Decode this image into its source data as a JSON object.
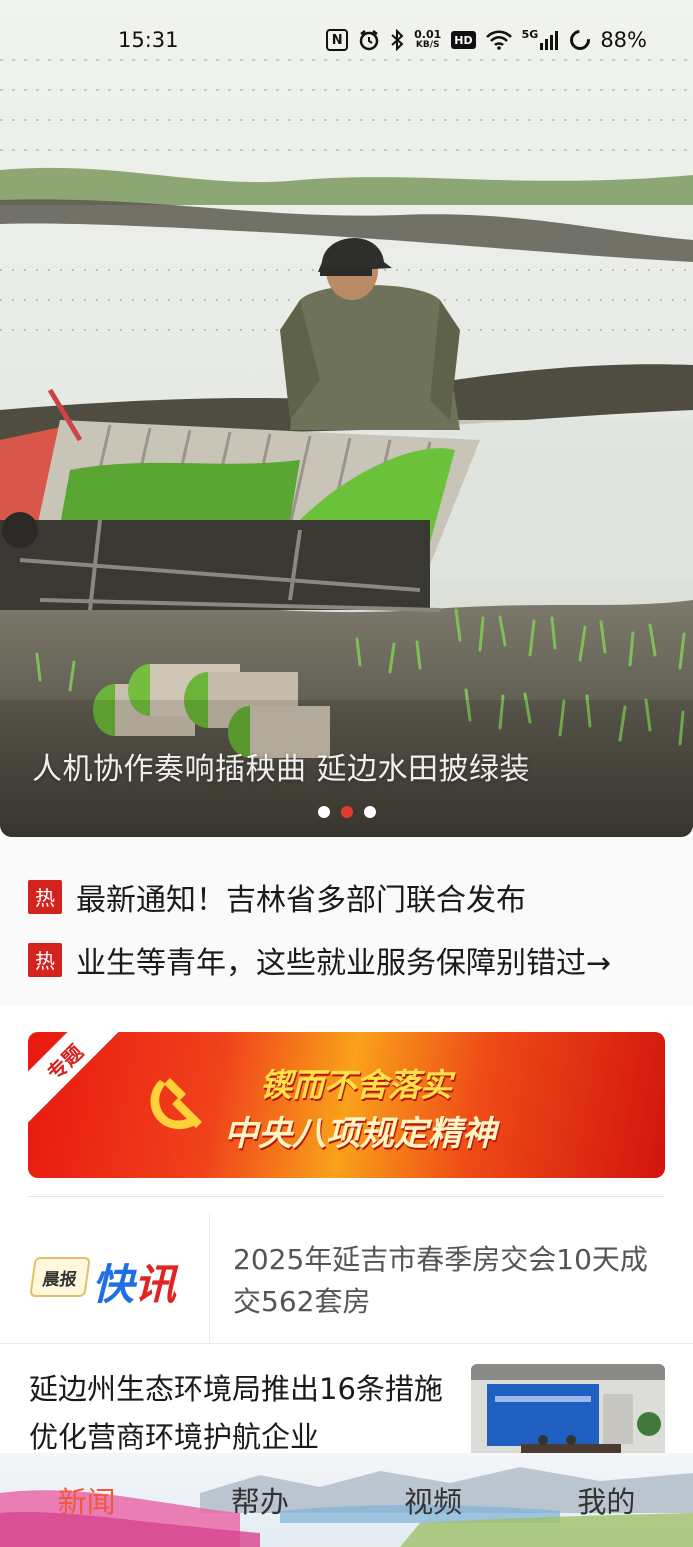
{
  "status_bar": {
    "time": "15:31",
    "network_speed_value": "0.01",
    "network_speed_unit": "KB/S",
    "hd_label": "HD",
    "signal_label": "5G",
    "battery": "88%",
    "icons": [
      "nfc-icon",
      "alarm-icon",
      "bluetooth-icon",
      "wifi-icon",
      "signal-icon",
      "battery-icon"
    ]
  },
  "hero": {
    "caption": "人机协作奏响插秧曲 延边水田披绿装",
    "slide_count": 3,
    "active_slide": 1
  },
  "hot_news": {
    "badge": "热",
    "items": [
      "最新通知！吉林省多部门联合发布",
      "业生等青年，这些就业服务保障别错过→"
    ]
  },
  "special_banner": {
    "tag": "专题",
    "line1": "锲而不舍落实",
    "line2": "中央八项规定精神"
  },
  "flash_news": {
    "logo_small": "晨报",
    "logo_big_1": "快",
    "logo_big_2": "讯",
    "headline": "2025年延吉市春季房交会10天成交562套房"
  },
  "article": {
    "title": "延边州生态环境局推出16条措施 优化营商环境护航企业"
  },
  "tab_bar": {
    "tabs": [
      "新闻",
      "帮办",
      "视频",
      "我的"
    ],
    "active": 0,
    "accent_color": "#f0583c"
  },
  "colors": {
    "hot_badge": "#d4231f",
    "active_dot": "#e23b30"
  }
}
